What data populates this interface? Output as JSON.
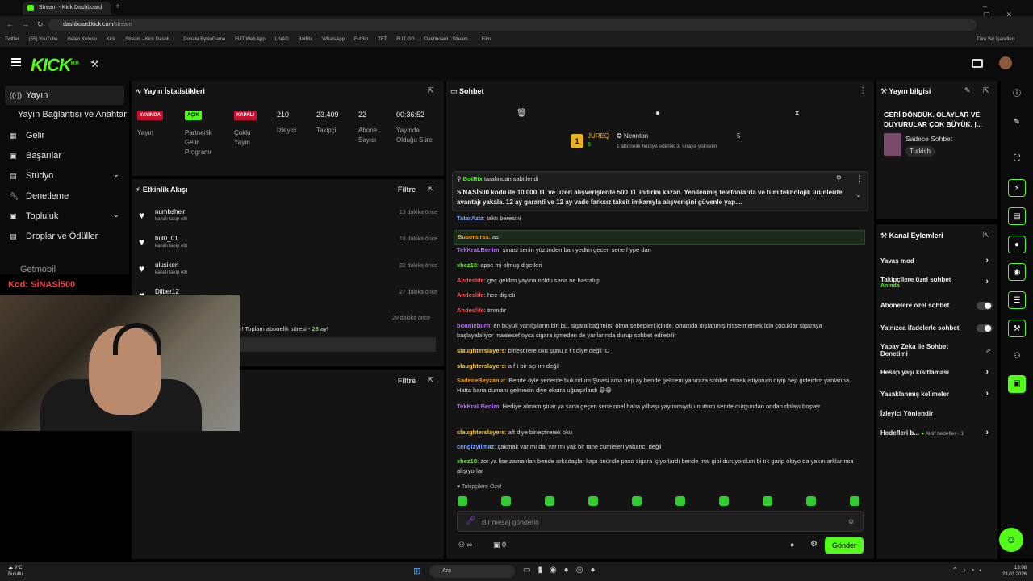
{
  "browser": {
    "tab_title": "Stream - Kick Dashboard",
    "url_host": "dashboard.kick.com",
    "url_path": "/stream",
    "bookmarks": [
      "Twitter",
      "(55) YouTube",
      "Gelen Kutusu",
      "Kick",
      "Stream - Kick Dashb...",
      "Donate ByNoGame",
      "FUT Web App",
      "LIVAD",
      "BotRix",
      "WhatsApp",
      "FutBin",
      "TFT",
      "FUT GG",
      "Dashboard / Stream...",
      "Film"
    ],
    "bookmarks_right": "Tüm Yer İşaretleri"
  },
  "kick": {
    "logo": "KICK",
    "logo_sup": "BETA"
  },
  "sidebar": {
    "items": [
      {
        "label": "Yayın"
      },
      {
        "label": "Yayın Bağlantısı ve Anahtarı"
      },
      {
        "label": "Gelir"
      },
      {
        "label": "Başarılar"
      },
      {
        "label": "Stüdyo"
      },
      {
        "label": "Denetleme"
      },
      {
        "label": "Topluluk"
      },
      {
        "label": "Droplar ve Ödüller"
      }
    ]
  },
  "overlay": {
    "getmobil": "Getmobil",
    "code": "Kod: SİNASİ500"
  },
  "stats": {
    "title": "Yayın İstatistikleri",
    "badges": [
      {
        "text": "YAYINDA",
        "label": "Yayın"
      },
      {
        "text": "AÇIK",
        "label": "Partnerlik Gelir Programı"
      },
      {
        "text": "KAPALI",
        "label": "Çoklu Yayın"
      }
    ],
    "numbers": [
      {
        "value": "210",
        "label": "İzleyici"
      },
      {
        "value": "23.409",
        "label": "Takipçi"
      },
      {
        "value": "22",
        "label": "Abone Sayısı"
      },
      {
        "value": "00:36:52",
        "label": "Yayında Olduğu Süre"
      }
    ]
  },
  "activity": {
    "title": "Etkinlik Akışı",
    "filter": "Filtre",
    "items": [
      {
        "name": "numbshein",
        "sub": "kanalı takip etti",
        "time": "13 dakika önce"
      },
      {
        "name": "bul0_01",
        "sub": "kanalı takip etti",
        "time": "18 dakika önce"
      },
      {
        "name": "ulusiken",
        "sub": "kanalı takip etti",
        "time": "22 dakika önce"
      },
      {
        "name": "Dilber12",
        "sub": "",
        "time": "27 dakika önce"
      }
    ],
    "sub_text": "r! Toplam abonelik süresi - ",
    "sub_months": "26",
    "sub_suffix": " ay!",
    "sub_time": "29 dakika önce",
    "second_filter": "Filtre"
  },
  "chat": {
    "title": "Sohbet",
    "top_user": "JUREQ",
    "top_user_count": "5",
    "gifter": "Nennton",
    "gifter_count": "5",
    "gifter_text": "1 abonelik hediye ederek 3. sıraya yükselin",
    "pinned_by": "BotRix",
    "pinned_by_suffix": "tarafından sabitlendi",
    "pinned_text": "SİNASİ500 kodu ile 10.000 TL ve üzeri alışverişlerde 500 TL indirim kazan.  Yenilenmiş telefonlarda ve tüm teknolojik ürünlerde avantajı yakala. 12 ay garanti ve 12 ay vade farksız taksit imkanıyla alışverişini güvenle yap....",
    "messages": [
      {
        "user": "TatarAziz",
        "color": "#7aa7ff",
        "text": "taktı beresini"
      },
      {
        "user": "Busenurss",
        "color": "#ff9f1a",
        "text": "as"
      },
      {
        "user": "TekKraLBenim",
        "color": "#b76bff",
        "text": "şinasi senin yüzünden ban yedim gecen sene hype dan"
      },
      {
        "user": "xhez10",
        "color": "#53fc18",
        "text": "apse mi olmuş dişetleri"
      },
      {
        "user": "Andeslife",
        "color": "#ff4d4d",
        "text": "geç geldim yayına noldu sana ne hastalıgı"
      },
      {
        "user": "Andeslife",
        "color": "#ff4d4d",
        "text": "hee diş eti"
      },
      {
        "user": "Andeslife",
        "color": "#ff4d4d",
        "text": "tmmdır"
      },
      {
        "user": "bonnieburn",
        "color": "#b76bff",
        "text": "en büyük yanılgıların biri bu, sigara bağımlısı olma sebepleri içinde, ortamda dışlanmış hissetmemek için çocuklar sigaraya başlayabiliyor maalesef oysa sigara içmeden de yanlarında durup sohbet edilebilir"
      },
      {
        "user": "slaughterslayers",
        "color": "#ffcc33",
        "text": "birleştirere oku şunu a f t diye değil :D"
      },
      {
        "user": "slaughterslayers",
        "color": "#ffcc33",
        "text": "a f t bir açılım değil"
      },
      {
        "user": "SadeceBeyzanur",
        "color": "#ff9f1a",
        "text": "Bende öyle yerlerde bulundum Şinasi ama hep ay bende gelicem yanınıza sohbet etmek istiyorum diyip hep giderdim yanlarına. Hatta bana dumanı gelmesin diye ekstra uğraşırlardı 😄😁"
      },
      {
        "user": "TekKraLBenim",
        "color": "#b76bff",
        "text": "Hediye almamıştılar ya sana geçen sene noel baba yılbaşı yayınımıydı unuttum sende durgundan ondan dolayı boşver"
      },
      {
        "user": "slaughterslayers",
        "color": "#ffcc33",
        "text": "aft diye birleştirerek oku"
      },
      {
        "user": "cengizyilmaz",
        "color": "#7aa7ff",
        "text": "çakmak var mı dal var mı yak bir tane cümleleri yabancı değil"
      },
      {
        "user": "xhez10",
        "color": "#53fc18",
        "text": "zor ya lise zamanları bende arkadaşlar kapı önünde paso sigara içiyorlardı bende mal gibi duruyordum bi tık garip oluyo da yakın arklarınsa alışıyorlar"
      }
    ],
    "followers_only": "Takipçilere Özel",
    "input_placeholder": "Bir mesaj gönderin",
    "infinity": "∞",
    "count": "0",
    "send": "Gönder"
  },
  "stream_info": {
    "title": "Yayın bilgisi",
    "stream_title": "GERİ DÖNDÜK. OLAYLAR VE DUYURULAR ÇOK BÜYÜK. |...",
    "category": "Sadece Sohbet",
    "language": "Turkish"
  },
  "channel_actions": {
    "title": "Kanal Eylemleri",
    "items": [
      {
        "label": "Yavaş mod",
        "kind": "chevron"
      },
      {
        "label": "Takipçilere özel sohbet",
        "sub": "Anında",
        "kind": "chevron"
      },
      {
        "label": "Abonelere özel sohbet",
        "kind": "toggle"
      },
      {
        "label": "Yalnızca ifadelerle sohbet",
        "kind": "toggle"
      },
      {
        "label": "Yapay Zeka ile Sohbet Denetimi",
        "kind": "external"
      },
      {
        "label": "Hesap yaşı kısıtlaması",
        "kind": "chevron"
      },
      {
        "label": "Yasaklanmış kelimeler",
        "kind": "chevron"
      },
      {
        "label": "İzleyici Yönlendir",
        "kind": "none"
      },
      {
        "label": "Hedefleri b...",
        "sub": "Aktif hedefler - 1",
        "kind": "chevron"
      }
    ]
  },
  "taskbar": {
    "weather_temp": "9°C",
    "weather_desc": "Bulutlu",
    "search": "Ara",
    "time": "13:08",
    "date": "23.03.2026"
  },
  "colors": {
    "kick_green": "#53fc18",
    "live_red": "#c8102e",
    "on_green": "#53fc18"
  }
}
